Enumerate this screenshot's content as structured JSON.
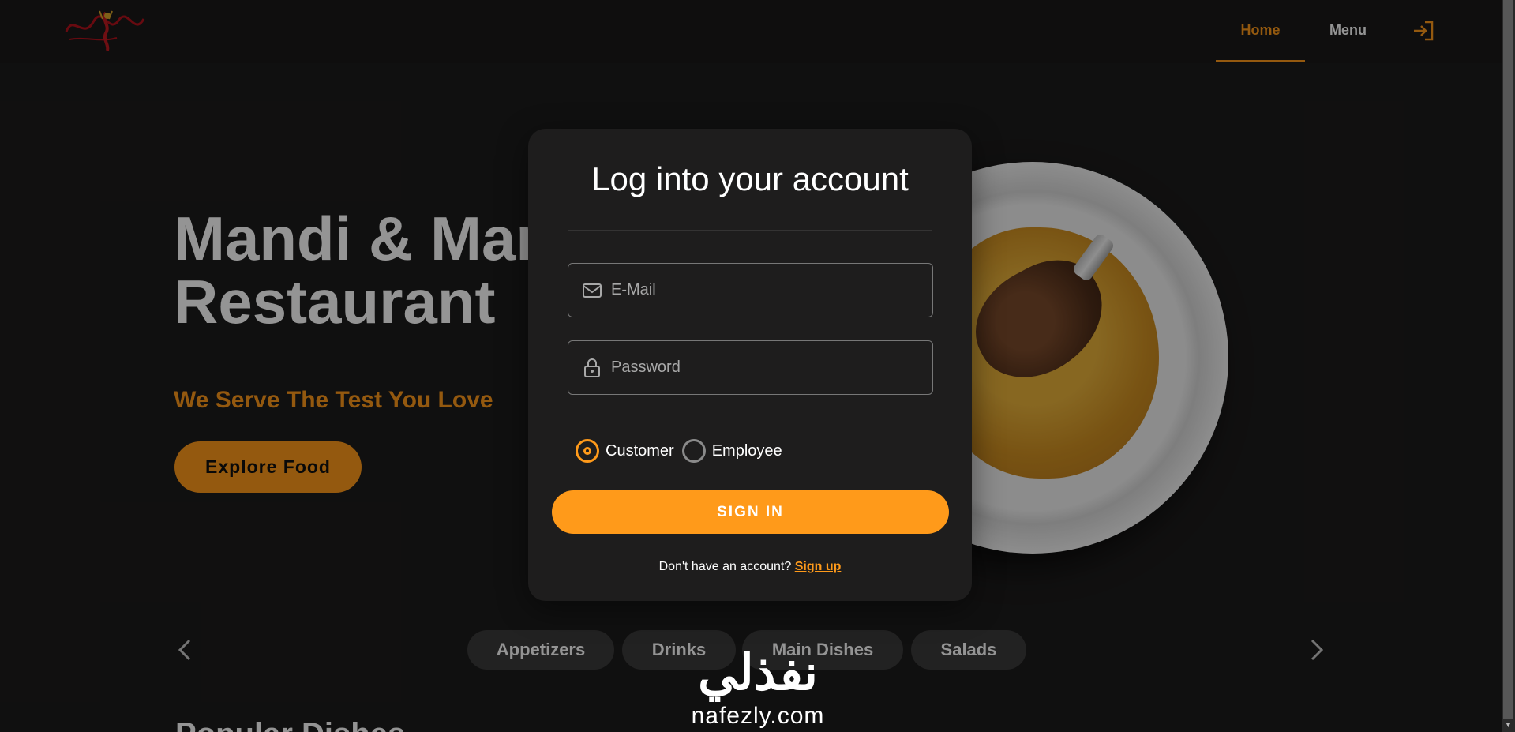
{
  "navbar": {
    "logo_alt": "مندي ومنسف",
    "home_label": "Home",
    "menu_label": "Menu",
    "login_icon": "login-icon"
  },
  "hero": {
    "title_line1": "Mandi & Mansaf",
    "title_line2": "Restaurant",
    "subtitle": "We Serve The Test You Love",
    "explore_label": "Explore Food"
  },
  "categories": {
    "items": [
      "Appetizers",
      "Drinks",
      "Main Dishes",
      "Salads"
    ]
  },
  "popular": {
    "heading": "Popular Dishes"
  },
  "login": {
    "title": "Log into your account",
    "email_placeholder": "E-Mail",
    "password_placeholder": "Password",
    "role_options": [
      "Customer",
      "Employee"
    ],
    "selected_role": "Customer",
    "signin_label": "SIGN IN",
    "signup_prompt": "Don't have an account?",
    "signup_link": "Sign up"
  },
  "watermark": {
    "arabic": "نفذلي",
    "latin": "nafezly.com"
  },
  "colors": {
    "accent": "#ff9a1a",
    "background": "#1d1c1c",
    "modal": "#1e1d1d"
  }
}
